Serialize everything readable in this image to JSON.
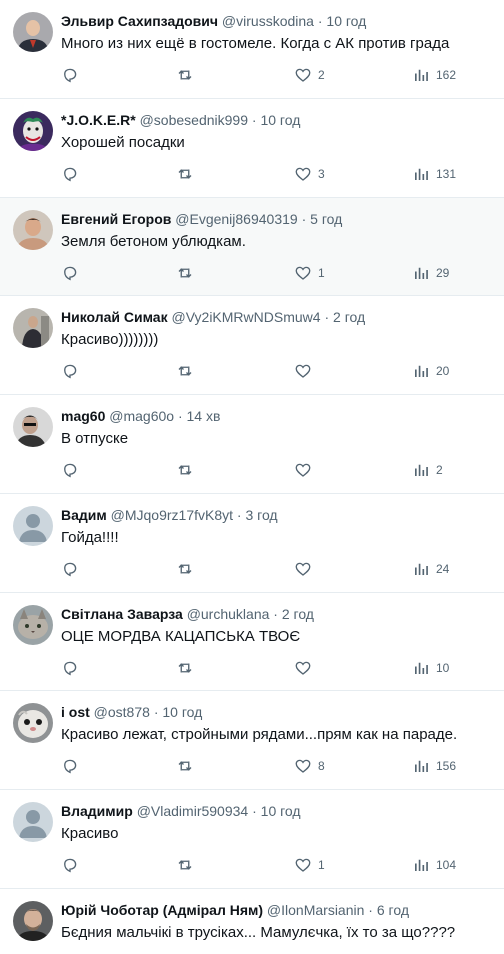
{
  "tweets": [
    {
      "name": "Эльвир Сахипзадович",
      "handle": "@virusskodina",
      "time": "10 год",
      "text": "Много из них ещё в гостомеле. Когда с АК  против града",
      "likes": "2",
      "views": "162"
    },
    {
      "name": "*J.O.K.E.R*",
      "handle": "@sobesednik999",
      "time": "10 год",
      "text": "Хорошей посадки",
      "likes": "3",
      "views": "131"
    },
    {
      "name": "Евгений Егоров",
      "handle": "@Evgenij86940319",
      "time": "5 год",
      "text": "Земля бетоном ублюдкам.",
      "likes": "1",
      "views": "29"
    },
    {
      "name": "Николай Симак",
      "handle": "@Vy2iKMRwNDSmuw4",
      "time": "2 год",
      "text": "Красиво))))))))",
      "likes": "",
      "views": "20"
    },
    {
      "name": "mag60",
      "handle": "@mag60o",
      "time": "14 хв",
      "text": "В отпуске",
      "likes": "",
      "views": "2"
    },
    {
      "name": "Вадим",
      "handle": "@MJqo9rz17fvK8yt",
      "time": "3 год",
      "text": "Гойда!!!!",
      "likes": "",
      "views": "24"
    },
    {
      "name": "Світлана Заварза",
      "handle": "@urchuklana",
      "time": "2 год",
      "text": "ОЦЕ МОРДВА КАЦАПСЬКА ТВОЄ",
      "likes": "",
      "views": "10"
    },
    {
      "name": "i ost",
      "handle": "@ost878",
      "time": "10 год",
      "text": "Красиво лежат, стройными рядами...прям как на параде.",
      "likes": "8",
      "views": "156"
    },
    {
      "name": "Владимир",
      "handle": "@Vladimir590934",
      "time": "10 год",
      "text": "Красиво",
      "likes": "1",
      "views": "104"
    },
    {
      "name": "Юрій Чоботар (Адмірал Ням)",
      "handle": "@IlonMarsianin",
      "time": "6 год",
      "text": "Бєдния мальчікі в трусіках... Мамулєчка, їх то за що????",
      "likes": "",
      "views": ""
    }
  ],
  "separator": "·",
  "icons": {
    "reply": "reply-icon",
    "retweet": "retweet-icon",
    "like": "like-icon",
    "views": "views-icon"
  },
  "colors": {
    "text": "#0f1419",
    "muted": "#536471",
    "border": "#e6ecf0",
    "highlight": "#f7f9f9"
  }
}
